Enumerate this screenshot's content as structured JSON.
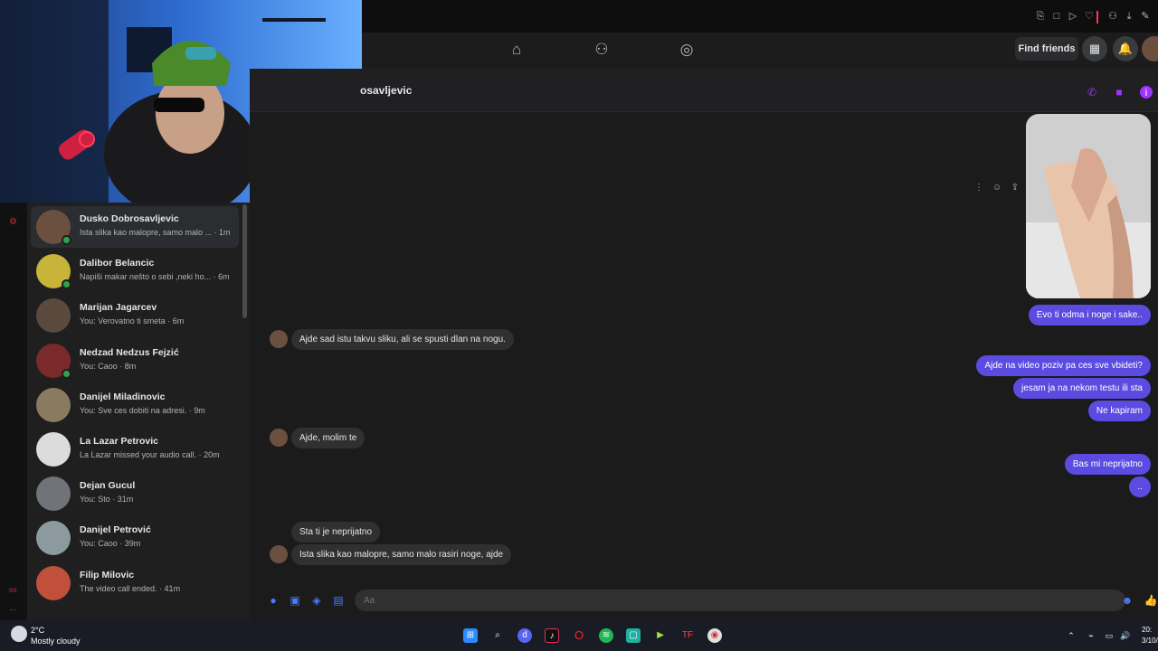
{
  "nav": {
    "find_friends": "Find friends",
    "icons": [
      "home-icon",
      "friends-icon",
      "groups-icon",
      "apps-grid-icon",
      "notifications-icon"
    ]
  },
  "conversation": {
    "name": "osavljevic",
    "header_icons": [
      "phone-icon",
      "video-icon",
      "info-icon"
    ],
    "messages": [
      {
        "dir": "out",
        "text": "Evo ti odma i noge i sake.."
      },
      {
        "dir": "in",
        "text": "Ajde sad istu takvu sliku, ali se spusti dlan na nogu."
      },
      {
        "dir": "out",
        "text": "Ajde na video poziv pa ces sve vbideti?"
      },
      {
        "dir": "out",
        "text": "jesam ja na nekom testu ili sta"
      },
      {
        "dir": "out",
        "text": "Ne kapiram"
      },
      {
        "dir": "in",
        "text": "Ajde, molim te"
      },
      {
        "dir": "out",
        "text": "Bas mi neprijatno"
      },
      {
        "dir": "out",
        "text": ".."
      },
      {
        "dir": "in",
        "text": "Sta ti je neprijatno"
      },
      {
        "dir": "in",
        "text": "Ista slika kao malopre, samo malo rasiri noge, ajde"
      }
    ],
    "composer_placeholder": "Aa"
  },
  "chats": [
    {
      "name": "Dusko Dobrosavljevic",
      "preview": "Ista slika kao malopre, samo malo ... · 1m",
      "online": true,
      "active": true,
      "color": "#6b5040"
    },
    {
      "name": "Dalibor Belancic",
      "preview": "Napiši makar nešto o sebi ,neki ho... · 6m",
      "online": true,
      "active": false,
      "color": "#c9b43a"
    },
    {
      "name": "Marijan Jagarcev",
      "preview": "You: Verovatno ti smeta · 6m",
      "online": false,
      "active": false,
      "color": "#5a4a3e"
    },
    {
      "name": "Nedzad Nedzus Fejzić",
      "preview": "You: Caoo · 8m",
      "online": true,
      "active": false,
      "color": "#7a2a2a"
    },
    {
      "name": "Danijel Miladinovic",
      "preview": "You: Sve ces dobiti na adresi. · 9m",
      "online": false,
      "active": false,
      "color": "#8a7a60"
    },
    {
      "name": "La Lazar Petrovic",
      "preview": "La Lazar missed your audio call. · 20m",
      "online": false,
      "active": false,
      "color": "#dcdcdc"
    },
    {
      "name": "Dejan Gucul",
      "preview": "You: Sto · 31m",
      "online": false,
      "active": false,
      "color": "#707478"
    },
    {
      "name": "Danijel Petrović",
      "preview": "You: Caoo · 39m",
      "online": false,
      "active": false,
      "color": "#8c9aa0"
    },
    {
      "name": "Filip Milovic",
      "preview": "The video call ended. · 41m",
      "online": false,
      "active": false,
      "color": "#c0503a"
    }
  ],
  "taskbar": {
    "weather_temp": "2°C",
    "weather_desc": "Mostly cloudy",
    "clock": "20:",
    "date": "3/10/",
    "apps": [
      "windows-start-icon",
      "search-icon",
      "discord-icon",
      "tiktok-icon",
      "opera-icon",
      "spotify-icon",
      "chat-app-icon",
      "game-icon",
      "app-icon",
      "chrome-icon"
    ]
  },
  "colors": {
    "accent": "#5b4be0",
    "messenger_purple": "#a033ff",
    "online": "#31a24c"
  }
}
